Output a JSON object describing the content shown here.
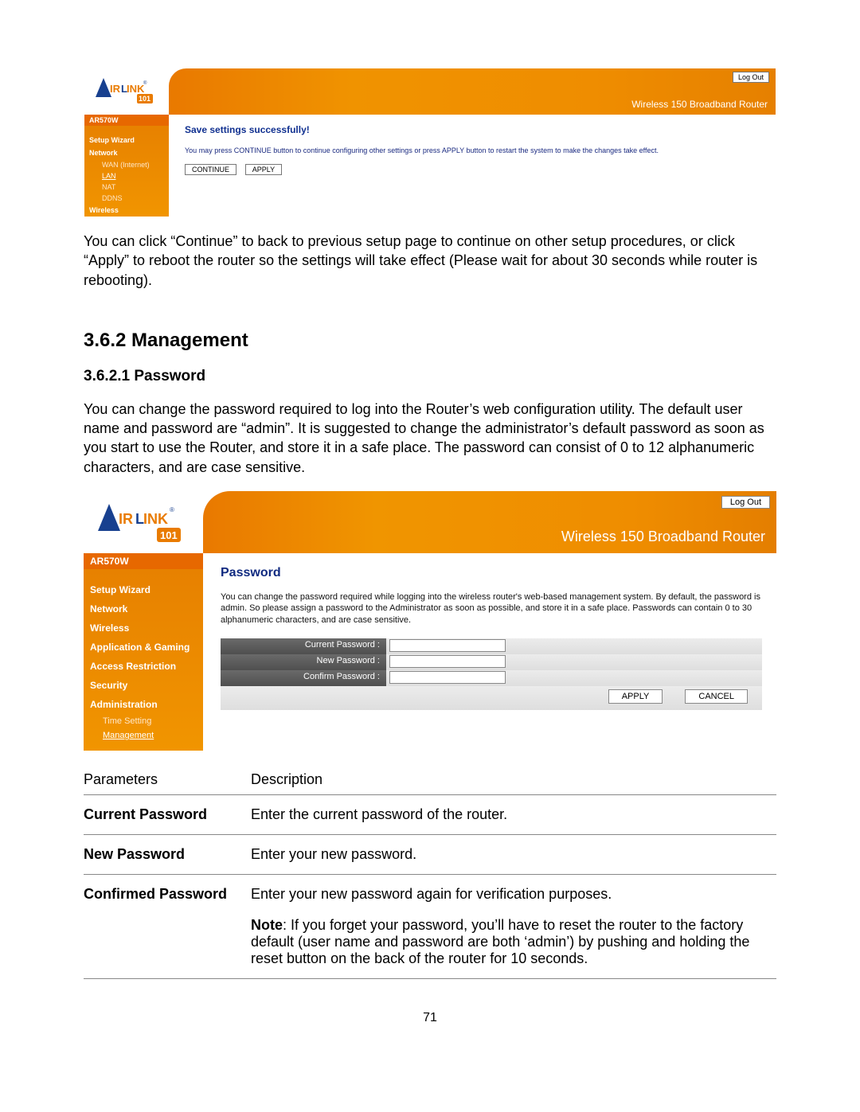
{
  "shot1": {
    "product_title": "Wireless 150 Broadband Router",
    "model": "AR570W",
    "logout": "Log Out",
    "nav": {
      "setup_wizard": "Setup Wizard",
      "network": "Network",
      "wan": "WAN (Internet)",
      "lan": "LAN",
      "nat": "NAT",
      "ddns": "DDNS",
      "wireless": "Wireless"
    },
    "heading": "Save settings successfully!",
    "msg": "You may press CONTINUE button to continue configuring other settings or press APPLY button to restart the system to make the changes take effect.",
    "continue_btn": "CONTINUE",
    "apply_btn": "APPLY"
  },
  "body1": "You can click “Continue” to back to previous setup page to continue on other setup procedures, or click “Apply” to reboot the router so the settings will take effect (Please wait for about 30 seconds while router is rebooting).",
  "h2": "3.6.2 Management",
  "h3": "3.6.2.1 Password",
  "body2": "You can change the password required to log into the Router’s web configuration utility. The default user name and password are “admin”. It is suggested to change the administrator’s default password as soon as you start to use the Router, and store it in a safe place. The password can consist of 0 to 12 alphanumeric characters, and are case sensitive.",
  "shot2": {
    "product_title": "Wireless 150 Broadband Router",
    "model": "AR570W",
    "logout": "Log Out",
    "nav": {
      "setup_wizard": "Setup Wizard",
      "network": "Network",
      "wireless": "Wireless",
      "app_gaming": "Application & Gaming",
      "access": "Access Restriction",
      "security": "Security",
      "admin": "Administration",
      "time": "Time Setting",
      "management": "Management"
    },
    "heading": "Password",
    "desc": "You can change the password required while logging into the wireless router's web-based management system. By default, the password is admin. So please assign a password to the Administrator as soon as possible, and store it in a safe place. Passwords can contain 0 to 30 alphanumeric characters, and are case sensitive.",
    "labels": {
      "current": "Current Password :",
      "new": "New Password :",
      "confirm": "Confirm Password :"
    },
    "apply_btn": "APPLY",
    "cancel_btn": "CANCEL"
  },
  "ptable": {
    "h_param": "Parameters",
    "h_desc": "Description",
    "rows": [
      {
        "p": "Current Password",
        "d": "Enter the current password of the router."
      },
      {
        "p": "New Password",
        "d": "Enter your new password."
      },
      {
        "p": "Confirmed Password",
        "d": "Enter your new password again for verification purposes."
      }
    ],
    "note_label": "Note",
    "note": ": If you forget your password, you’ll have to reset the router to the factory default (user name and password are both ‘admin’) by pushing and holding the reset button on the back of the router for 10 seconds."
  },
  "page_number": "71"
}
